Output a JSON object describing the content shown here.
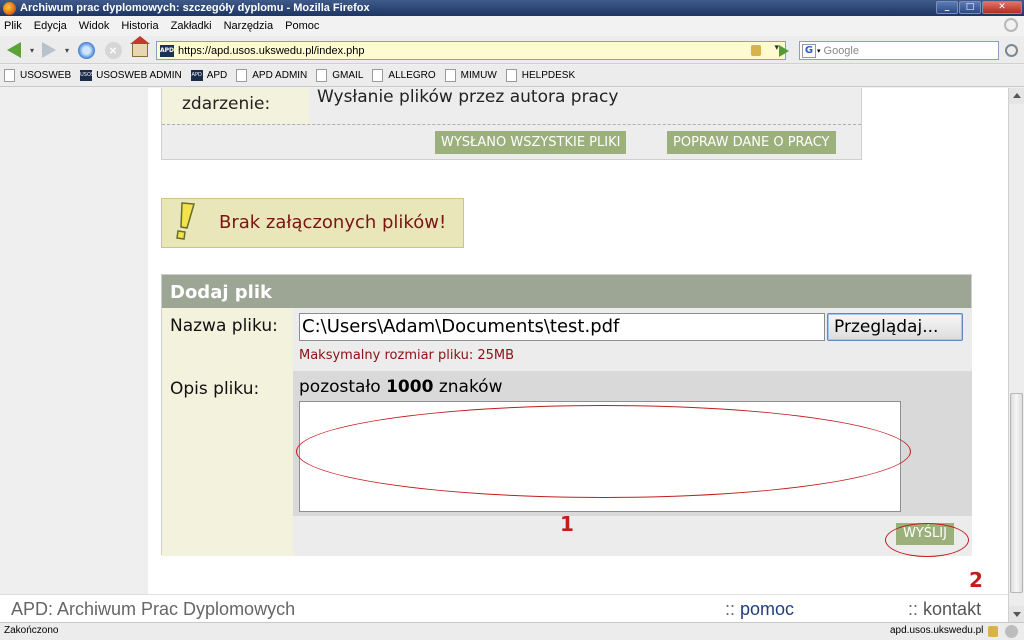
{
  "window": {
    "title": "Archiwum prac dyplomowych: szczegóły dyplomu - Mozilla Firefox"
  },
  "menu": [
    "Plik",
    "Edycja",
    "Widok",
    "Historia",
    "Zakładki",
    "Narzędzia",
    "Pomoc"
  ],
  "toolbar": {
    "url_favicon": "APD",
    "url": "https://apd.usos.ukswedu.pl/index.php",
    "search_engine": "G",
    "search_placeholder": "Google"
  },
  "bookmarks": [
    {
      "label": "USOSWEB",
      "icon": "page-icon"
    },
    {
      "label": "USOSWEB ADMIN",
      "icon": "usos-icon"
    },
    {
      "label": "APD",
      "icon": "apd-icon"
    },
    {
      "label": "APD ADMIN",
      "icon": "page-icon"
    },
    {
      "label": "GMAIL",
      "icon": "page-icon"
    },
    {
      "label": "ALLEGRO",
      "icon": "page-icon"
    },
    {
      "label": "MIMUW",
      "icon": "page-icon"
    },
    {
      "label": "HELPDESK",
      "icon": "page-icon"
    }
  ],
  "event": {
    "label": "zdarzenie:",
    "value": "Wysłanie plików przez autora pracy",
    "btn_sent": "WYSŁANO WSZYSTKIE PLIKI",
    "btn_edit": "POPRAW DANE O PRACY"
  },
  "warning": {
    "text": "Brak załączonych plików!"
  },
  "form": {
    "header": "Dodaj plik",
    "filename_label": "Nazwa pliku:",
    "filename_value": "C:\\Users\\Adam\\Documents\\test.pdf",
    "browse_label": "Przeglądaj...",
    "max_size": "Maksymalny rozmiar pliku: 25MB",
    "description_label": "Opis pliku:",
    "remaining_prefix": "pozostało ",
    "remaining_count": "1000",
    "remaining_suffix": " znaków",
    "description_value": "",
    "send_label": "WYŚLIJ"
  },
  "annotations": {
    "num1": "1",
    "num2": "2",
    "color": "#c21d1d"
  },
  "footer": {
    "site": "APD: Archiwum Prac Dyplomowych",
    "sep": "::",
    "help": "pomoc",
    "contact": "kontakt"
  },
  "status": {
    "text": "Zakończono",
    "domain": "apd.usos.ukswedu.pl"
  },
  "colors": {
    "button_green": "#9bb07a",
    "form_header": "#9da594",
    "warning_bg": "#e9e6ba",
    "warning_text": "#7a1515"
  }
}
